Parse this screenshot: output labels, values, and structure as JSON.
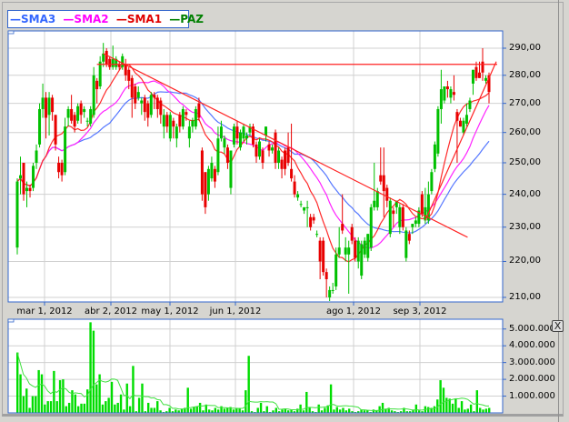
{
  "legend": [
    {
      "label": "SMA3",
      "color": "#3366ff"
    },
    {
      "label": "SMA2",
      "color": "#ff00ff"
    },
    {
      "label": "SMA1",
      "color": "#e00000"
    },
    {
      "label": "PAZ",
      "color": "#008000"
    }
  ],
  "colors": {
    "up": "#00c000",
    "down": "#e80000",
    "grid": "#d0d0d0",
    "border": "#3366cc",
    "volume": "#00dd00",
    "volume_avg": "#40e040",
    "trendline": "#ff2020"
  },
  "close_label": "X",
  "chart_data": [
    {
      "type": "candlestick",
      "title": "PAZ",
      "scale": "log",
      "ylim": [
        208,
        293
      ],
      "y_ticks": [
        "290,00",
        "280,00",
        "270,00",
        "260,00",
        "250,00",
        "240,00",
        "230,00",
        "220,00",
        "210,00"
      ],
      "y_tick_values": [
        290,
        280,
        270,
        260,
        250,
        240,
        230,
        220,
        210
      ],
      "x_tick_labels": [
        "mar 1, 2012",
        "abr 2, 2012",
        "may 1, 2012",
        "jun 1, 2012",
        "ago 1, 2012",
        "sep 3, 2012"
      ],
      "sma_periods": {
        "SMA1": 10,
        "SMA2": 20,
        "SMA3": 30
      },
      "trendlines": [
        {
          "name": "downtrend",
          "from": [
            27,
            288
          ],
          "to": [
            139,
            227
          ]
        },
        {
          "name": "resistance",
          "from": [
            25,
            284
          ],
          "to": [
            149,
            284
          ]
        },
        {
          "name": "uptrend",
          "from": [
            128,
            232
          ],
          "to": [
            148,
            285
          ]
        }
      ],
      "ohlc": [
        [
          224,
          245,
          222,
          244
        ],
        [
          245,
          252,
          240,
          246
        ],
        [
          250,
          250,
          238,
          240
        ],
        [
          241,
          244,
          236,
          242
        ],
        [
          242,
          243,
          239,
          241
        ],
        [
          242,
          250,
          241,
          249
        ],
        [
          250,
          256,
          248,
          254
        ],
        [
          256,
          270,
          255,
          268
        ],
        [
          268,
          277,
          265,
          272
        ],
        [
          272,
          274,
          258,
          265
        ],
        [
          266,
          274,
          259,
          272
        ],
        [
          272,
          273,
          264,
          267
        ],
        [
          266,
          266,
          254,
          256
        ],
        [
          250,
          252,
          245,
          247
        ],
        [
          250,
          251,
          244,
          246
        ],
        [
          247,
          265,
          246,
          262
        ],
        [
          265,
          269,
          262,
          268
        ],
        [
          268,
          273,
          263,
          264
        ],
        [
          266,
          267,
          260,
          262
        ],
        [
          264,
          270,
          263,
          269
        ],
        [
          270,
          271,
          263,
          266
        ],
        [
          267,
          269,
          265,
          268
        ],
        [
          264,
          265,
          262,
          264
        ],
        [
          263,
          269,
          262,
          268
        ],
        [
          266,
          283,
          265,
          280
        ],
        [
          278,
          279,
          270,
          275
        ],
        [
          276,
          287,
          275,
          285
        ],
        [
          285,
          292,
          283,
          288
        ],
        [
          289,
          290,
          283,
          284
        ],
        [
          286,
          287,
          282,
          283
        ],
        [
          283,
          291,
          282,
          286
        ],
        [
          283,
          287,
          282,
          286
        ],
        [
          284,
          285,
          282,
          283
        ],
        [
          283,
          288,
          282,
          287
        ],
        [
          284,
          286,
          278,
          280
        ],
        [
          282,
          283,
          275,
          278
        ],
        [
          279,
          280,
          265,
          272
        ],
        [
          276,
          277,
          268,
          270
        ],
        [
          272,
          276,
          271,
          274
        ],
        [
          270,
          272,
          266,
          271
        ],
        [
          272,
          273,
          264,
          267
        ],
        [
          270,
          271,
          262,
          265
        ],
        [
          266,
          274,
          265,
          273
        ],
        [
          273,
          274,
          268,
          272
        ],
        [
          272,
          273,
          265,
          268
        ],
        [
          271,
          272,
          263,
          266
        ],
        [
          262,
          268,
          258,
          266
        ],
        [
          266,
          267,
          260,
          262
        ],
        [
          258,
          267,
          257,
          266
        ],
        [
          264,
          265,
          258,
          262
        ],
        [
          258,
          263,
          255,
          262
        ],
        [
          266,
          267,
          260,
          262
        ],
        [
          262,
          269,
          261,
          268
        ],
        [
          267,
          268,
          264,
          266
        ],
        [
          258,
          264,
          255,
          262
        ],
        [
          262,
          265,
          260,
          264
        ],
        [
          262,
          269,
          261,
          268
        ],
        [
          270,
          272,
          264,
          265
        ],
        [
          254,
          255,
          238,
          240
        ],
        [
          247,
          247,
          234,
          236
        ],
        [
          240,
          249,
          238,
          248
        ],
        [
          245,
          252,
          244,
          250
        ],
        [
          248,
          249,
          242,
          244
        ],
        [
          247,
          262,
          246,
          258
        ],
        [
          258,
          264,
          257,
          262
        ],
        [
          255,
          259,
          253,
          258
        ],
        [
          255,
          256,
          248,
          250
        ],
        [
          242,
          254,
          240,
          254
        ],
        [
          256,
          263,
          255,
          262
        ],
        [
          262,
          264,
          256,
          258
        ],
        [
          255,
          261,
          254,
          260
        ],
        [
          258,
          263,
          257,
          262
        ],
        [
          258,
          260,
          256,
          259
        ],
        [
          260,
          263,
          259,
          262
        ],
        [
          262,
          263,
          255,
          256
        ],
        [
          256,
          257,
          250,
          252
        ],
        [
          252,
          258,
          251,
          257
        ],
        [
          254,
          255,
          248,
          250
        ],
        [
          259,
          262,
          257,
          262
        ],
        [
          256,
          257,
          252,
          254
        ],
        [
          254,
          256,
          253,
          255
        ],
        [
          260,
          261,
          248,
          250
        ],
        [
          250,
          255,
          248,
          254
        ],
        [
          251,
          252,
          245,
          248
        ],
        [
          254,
          255,
          246,
          248
        ],
        [
          255,
          260,
          249,
          250
        ],
        [
          248,
          263,
          244,
          245
        ],
        [
          244,
          246,
          239,
          240
        ],
        [
          239,
          241,
          238,
          240
        ],
        [
          237,
          238,
          236,
          237
        ],
        [
          235,
          236,
          234,
          236
        ],
        [
          236,
          238,
          230,
          236
        ],
        [
          233,
          234,
          229,
          230
        ],
        [
          233,
          234,
          231,
          232
        ],
        [
          228,
          229,
          227,
          228
        ],
        [
          226,
          227,
          215,
          220
        ],
        [
          226,
          227,
          216,
          217
        ],
        [
          217,
          218,
          210,
          215
        ],
        [
          210,
          213,
          209,
          212
        ],
        [
          212,
          214,
          211,
          212
        ],
        [
          213,
          224,
          212,
          222
        ],
        [
          222,
          230,
          221,
          224
        ],
        [
          231,
          240,
          228,
          229
        ],
        [
          222,
          227,
          220,
          224
        ],
        [
          222,
          226,
          211,
          224
        ],
        [
          230,
          231,
          225,
          226
        ],
        [
          226,
          227,
          220,
          221
        ],
        [
          220,
          227,
          218,
          226
        ],
        [
          216,
          226,
          215,
          225
        ],
        [
          222,
          227,
          221,
          226
        ],
        [
          221,
          228,
          220,
          228
        ],
        [
          224,
          237,
          223,
          236
        ],
        [
          236,
          250,
          235,
          238
        ],
        [
          236,
          242,
          235,
          241
        ],
        [
          246,
          255,
          243,
          244
        ],
        [
          246,
          255,
          233,
          241
        ],
        [
          242,
          243,
          236,
          238
        ],
        [
          228,
          239,
          227,
          238
        ],
        [
          235,
          236,
          230,
          234
        ],
        [
          236,
          238,
          234,
          238
        ],
        [
          230,
          237,
          228,
          236
        ],
        [
          236,
          237,
          229,
          230
        ],
        [
          221,
          230,
          220,
          229
        ],
        [
          228,
          229,
          225,
          226
        ],
        [
          230,
          231,
          228,
          231
        ],
        [
          231,
          233,
          230,
          232
        ],
        [
          231,
          236,
          230,
          235
        ],
        [
          240,
          241,
          233,
          234
        ],
        [
          232,
          242,
          231,
          236
        ],
        [
          232,
          244,
          231,
          240
        ],
        [
          241,
          248,
          240,
          247
        ],
        [
          248,
          257,
          247,
          256
        ],
        [
          253,
          269,
          252,
          268
        ],
        [
          268,
          282,
          263,
          275
        ],
        [
          271,
          276,
          270,
          276
        ],
        [
          276,
          278,
          272,
          275
        ],
        [
          272,
          276,
          270,
          275
        ],
        [
          274,
          280,
          271,
          273
        ],
        [
          267,
          268,
          250,
          264
        ],
        [
          264,
          265,
          262,
          262
        ],
        [
          260,
          265,
          259,
          264
        ],
        [
          263,
          270,
          262,
          266
        ],
        [
          268,
          272,
          267,
          271
        ],
        [
          277,
          282,
          273,
          282
        ],
        [
          283,
          285,
          278,
          279
        ],
        [
          281,
          285,
          279,
          279
        ],
        [
          285,
          290,
          278,
          281
        ],
        [
          278,
          280,
          277,
          279
        ],
        [
          280,
          281,
          270,
          274
        ]
      ]
    },
    {
      "type": "bar",
      "title": "Volume",
      "ylim": [
        0,
        5500000
      ],
      "y_ticks": [
        "5.000.000",
        "4.000.000",
        "3.000.000",
        "2.000.000",
        "1.000.000"
      ],
      "y_tick_values": [
        5000000,
        4000000,
        3000000,
        2000000,
        1000000
      ],
      "avg_period": 10,
      "values_thousands": [
        3600,
        2300,
        1000,
        1450,
        300,
        1000,
        1000,
        2550,
        2300,
        500,
        700,
        700,
        2500,
        700,
        1950,
        2000,
        400,
        600,
        1350,
        1100,
        400,
        550,
        550,
        1400,
        5400,
        4900,
        1700,
        2300,
        500,
        700,
        900,
        1850,
        500,
        600,
        1100,
        200,
        1750,
        400,
        2800,
        100,
        900,
        1750,
        100,
        600,
        300,
        300,
        700,
        150,
        50,
        100,
        300,
        100,
        200,
        150,
        250,
        300,
        1500,
        250,
        350,
        400,
        600,
        150,
        500,
        200,
        150,
        300,
        200,
        400,
        250,
        300,
        350,
        200,
        300,
        250,
        150,
        1350,
        3400,
        100,
        50,
        300,
        600,
        100,
        400,
        50,
        150,
        300,
        100,
        200,
        250,
        150,
        200,
        100,
        250,
        500,
        150,
        1250,
        300,
        100,
        50,
        500,
        150,
        300,
        450,
        1700,
        200,
        350,
        200,
        300,
        150,
        250,
        100,
        50,
        100,
        200,
        150,
        150,
        50,
        200,
        150,
        400,
        600,
        250,
        300,
        150,
        100,
        50,
        100,
        300,
        100,
        100,
        200,
        500,
        150,
        100,
        400,
        350,
        300,
        400,
        800,
        1950,
        1500,
        900,
        850,
        550,
        850,
        300,
        700,
        200,
        250,
        500,
        100,
        1350,
        300,
        200,
        250,
        300
      ]
    }
  ]
}
